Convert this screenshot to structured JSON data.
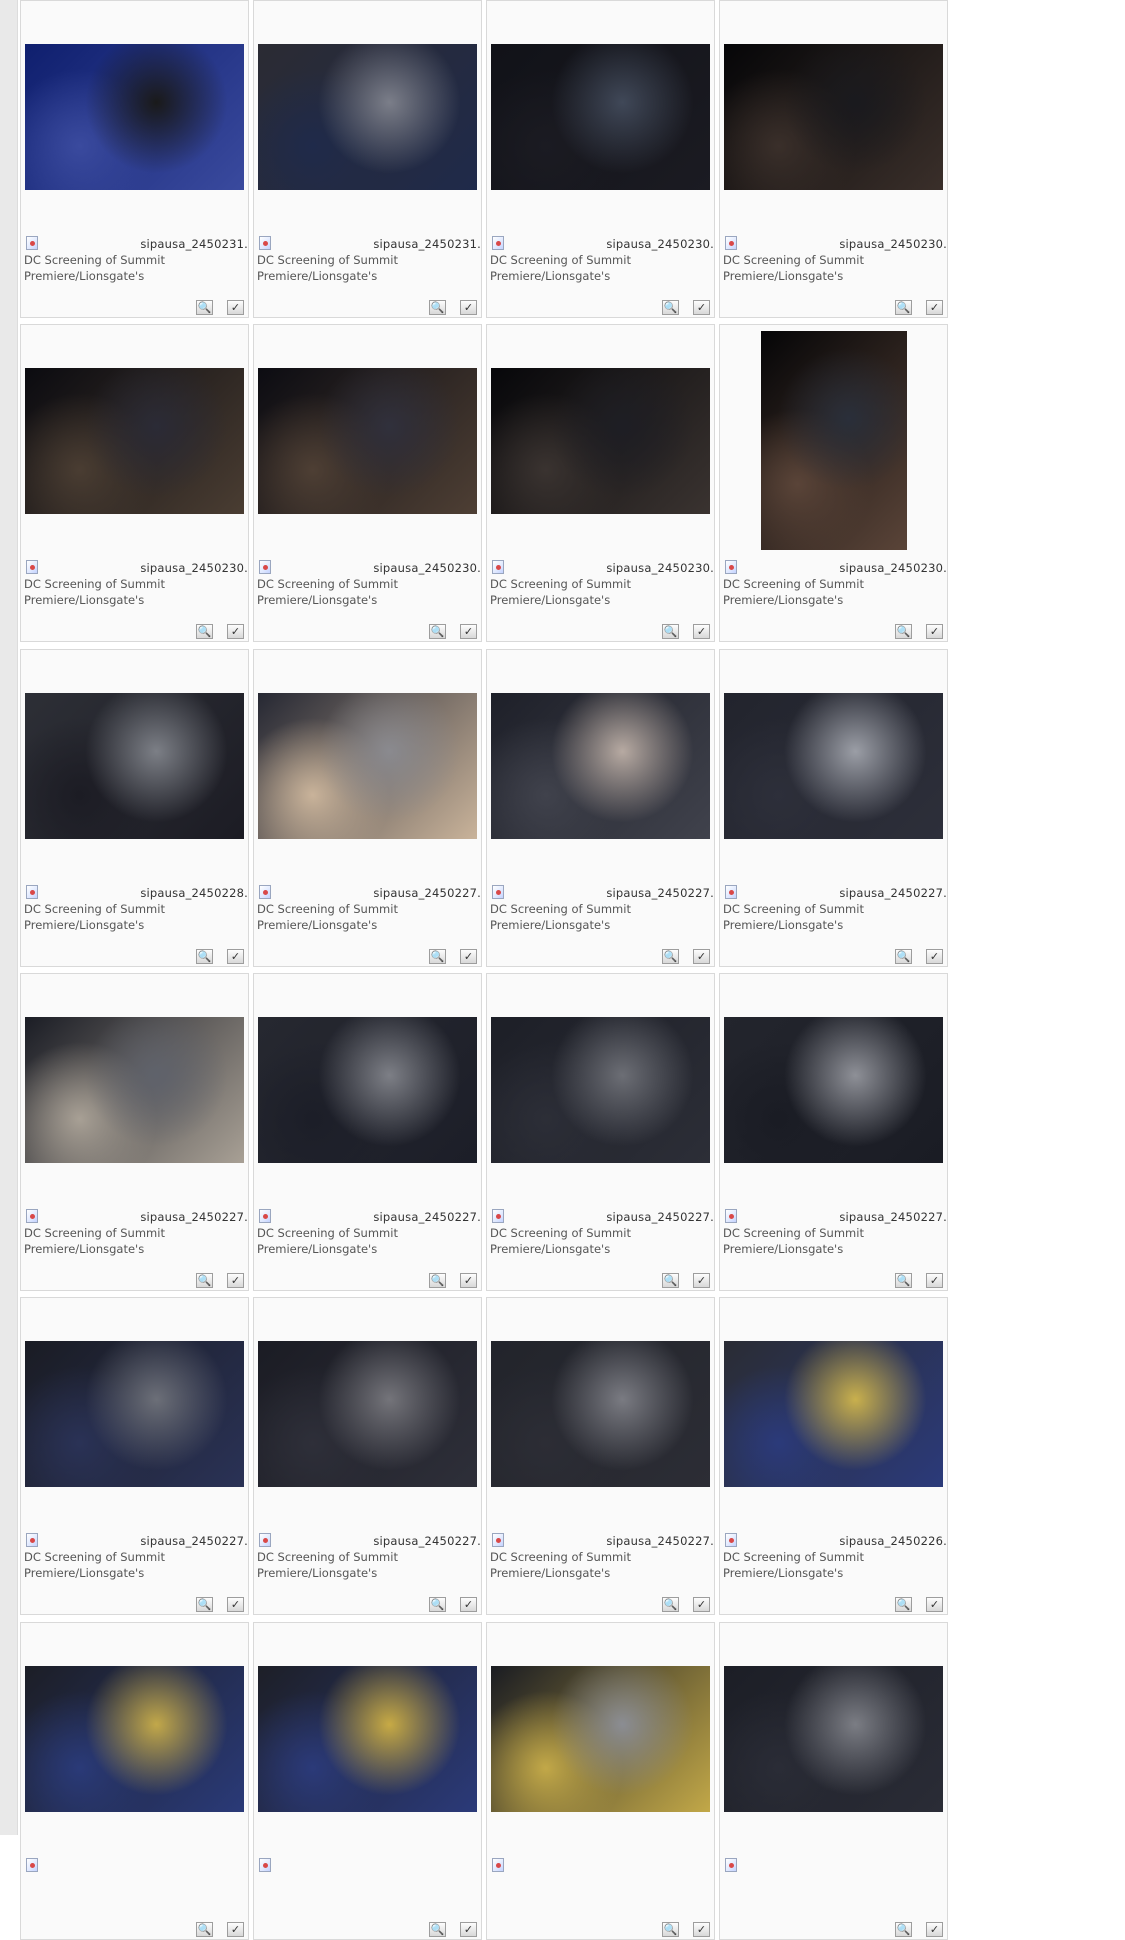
{
  "gallery": {
    "items": [
      {
        "filename": "sipausa_2450231.",
        "caption": "DC Screening of Summit Premiere/Lionsgate's",
        "colors": [
          "#0f1f6e",
          "#1a1a1a",
          "#3a4a9e"
        ],
        "orientation": "landscape"
      },
      {
        "filename": "sipausa_2450231.",
        "caption": "DC Screening of Summit Premiere/Lionsgate's",
        "colors": [
          "#2b2b33",
          "#7b7e89",
          "#1f2a4a"
        ],
        "orientation": "landscape"
      },
      {
        "filename": "sipausa_2450230.",
        "caption": "DC Screening of Summit Premiere/Lionsgate's",
        "colors": [
          "#111218",
          "#404858",
          "#1b1b22"
        ],
        "orientation": "landscape"
      },
      {
        "filename": "sipausa_2450230.",
        "caption": "DC Screening of Summit Premiere/Lionsgate's",
        "colors": [
          "#060608",
          "#1a1a1e",
          "#3a2f2a"
        ],
        "orientation": "landscape"
      },
      {
        "filename": "sipausa_2450230.",
        "caption": "DC Screening of Summit Premiere/Lionsgate's",
        "colors": [
          "#0b0b10",
          "#2b2b36",
          "#4a3d32"
        ],
        "orientation": "landscape"
      },
      {
        "filename": "sipausa_2450230.",
        "caption": "DC Screening of Summit Premiere/Lionsgate's",
        "colors": [
          "#0c0c12",
          "#30303c",
          "#4e3f34"
        ],
        "orientation": "landscape"
      },
      {
        "filename": "sipausa_2450230.",
        "caption": "DC Screening of Summit Premiere/Lionsgate's",
        "colors": [
          "#07070a",
          "#1e1e24",
          "#3a3330"
        ],
        "orientation": "landscape"
      },
      {
        "filename": "sipausa_2450230.",
        "caption": "DC Screening of Summit Premiere/Lionsgate's",
        "colors": [
          "#050507",
          "#2a2f3a",
          "#5a4438"
        ],
        "orientation": "portrait"
      },
      {
        "filename": "sipausa_2450228.",
        "caption": "DC Screening of Summit Premiere/Lionsgate's",
        "colors": [
          "#2d2f36",
          "#7c7f86",
          "#1c1c24"
        ],
        "orientation": "landscape"
      },
      {
        "filename": "sipausa_2450227.",
        "caption": "DC Screening of Summit Premiere/Lionsgate's",
        "colors": [
          "#262833",
          "#8a8a8f",
          "#c9b39a"
        ],
        "orientation": "landscape"
      },
      {
        "filename": "sipausa_2450227.",
        "caption": "DC Screening of Summit Premiere/Lionsgate's",
        "colors": [
          "#1e2029",
          "#b7aaa2",
          "#40424c"
        ],
        "orientation": "landscape"
      },
      {
        "filename": "sipausa_2450227.",
        "caption": "DC Screening of Summit Premiere/Lionsgate's",
        "colors": [
          "#22242d",
          "#9b9ea6",
          "#2d2f3a"
        ],
        "orientation": "landscape"
      },
      {
        "filename": "sipausa_2450227.",
        "caption": "DC Screening of Summit Premiere/Lionsgate's",
        "colors": [
          "#1b1d25",
          "#5f626b",
          "#a8a095"
        ],
        "orientation": "landscape"
      },
      {
        "filename": "sipausa_2450227.",
        "caption": "DC Screening of Summit Premiere/Lionsgate's",
        "colors": [
          "#262830",
          "#7d7f86",
          "#1c1e28"
        ],
        "orientation": "landscape"
      },
      {
        "filename": "sipausa_2450227.",
        "caption": "DC Screening of Summit Premiere/Lionsgate's",
        "colors": [
          "#1d1f27",
          "#6c6e75",
          "#2c2e37"
        ],
        "orientation": "landscape"
      },
      {
        "filename": "sipausa_2450227.",
        "caption": "DC Screening of Summit Premiere/Lionsgate's",
        "colors": [
          "#23252d",
          "#8e9097",
          "#1a1c24"
        ],
        "orientation": "landscape"
      },
      {
        "filename": "sipausa_2450227.",
        "caption": "DC Screening of Summit Premiere/Lionsgate's",
        "colors": [
          "#1a1c24",
          "#6c6f78",
          "#2a3256"
        ],
        "orientation": "landscape"
      },
      {
        "filename": "sipausa_2450227.",
        "caption": "DC Screening of Summit Premiere/Lionsgate's",
        "colors": [
          "#1b1c24",
          "#74747a",
          "#2e2f39"
        ],
        "orientation": "landscape"
      },
      {
        "filename": "sipausa_2450227.",
        "caption": "DC Screening of Summit Premiere/Lionsgate's",
        "colors": [
          "#22242b",
          "#7a7b82",
          "#2c2d35"
        ],
        "orientation": "landscape"
      },
      {
        "filename": "sipausa_2450226.",
        "caption": "DC Screening of Summit Premiere/Lionsgate's",
        "colors": [
          "#2a2c34",
          "#c9b04d",
          "#2b3a7a"
        ],
        "orientation": "landscape"
      },
      {
        "filename": "",
        "caption": "",
        "colors": [
          "#1c1e26",
          "#c2a84a",
          "#2a3a78"
        ],
        "orientation": "landscape"
      },
      {
        "filename": "",
        "caption": "",
        "colors": [
          "#1d1f27",
          "#c7aa45",
          "#2b3a79"
        ],
        "orientation": "landscape"
      },
      {
        "filename": "",
        "caption": "",
        "colors": [
          "#1a1c22",
          "#8b8d93",
          "#c2a848"
        ],
        "orientation": "landscape"
      },
      {
        "filename": "",
        "caption": "",
        "colors": [
          "#1c1e26",
          "#7b7d84",
          "#2a2c36"
        ],
        "orientation": "landscape"
      }
    ],
    "zoom_button_glyph": "🔍",
    "select_button_glyph": "✓"
  }
}
